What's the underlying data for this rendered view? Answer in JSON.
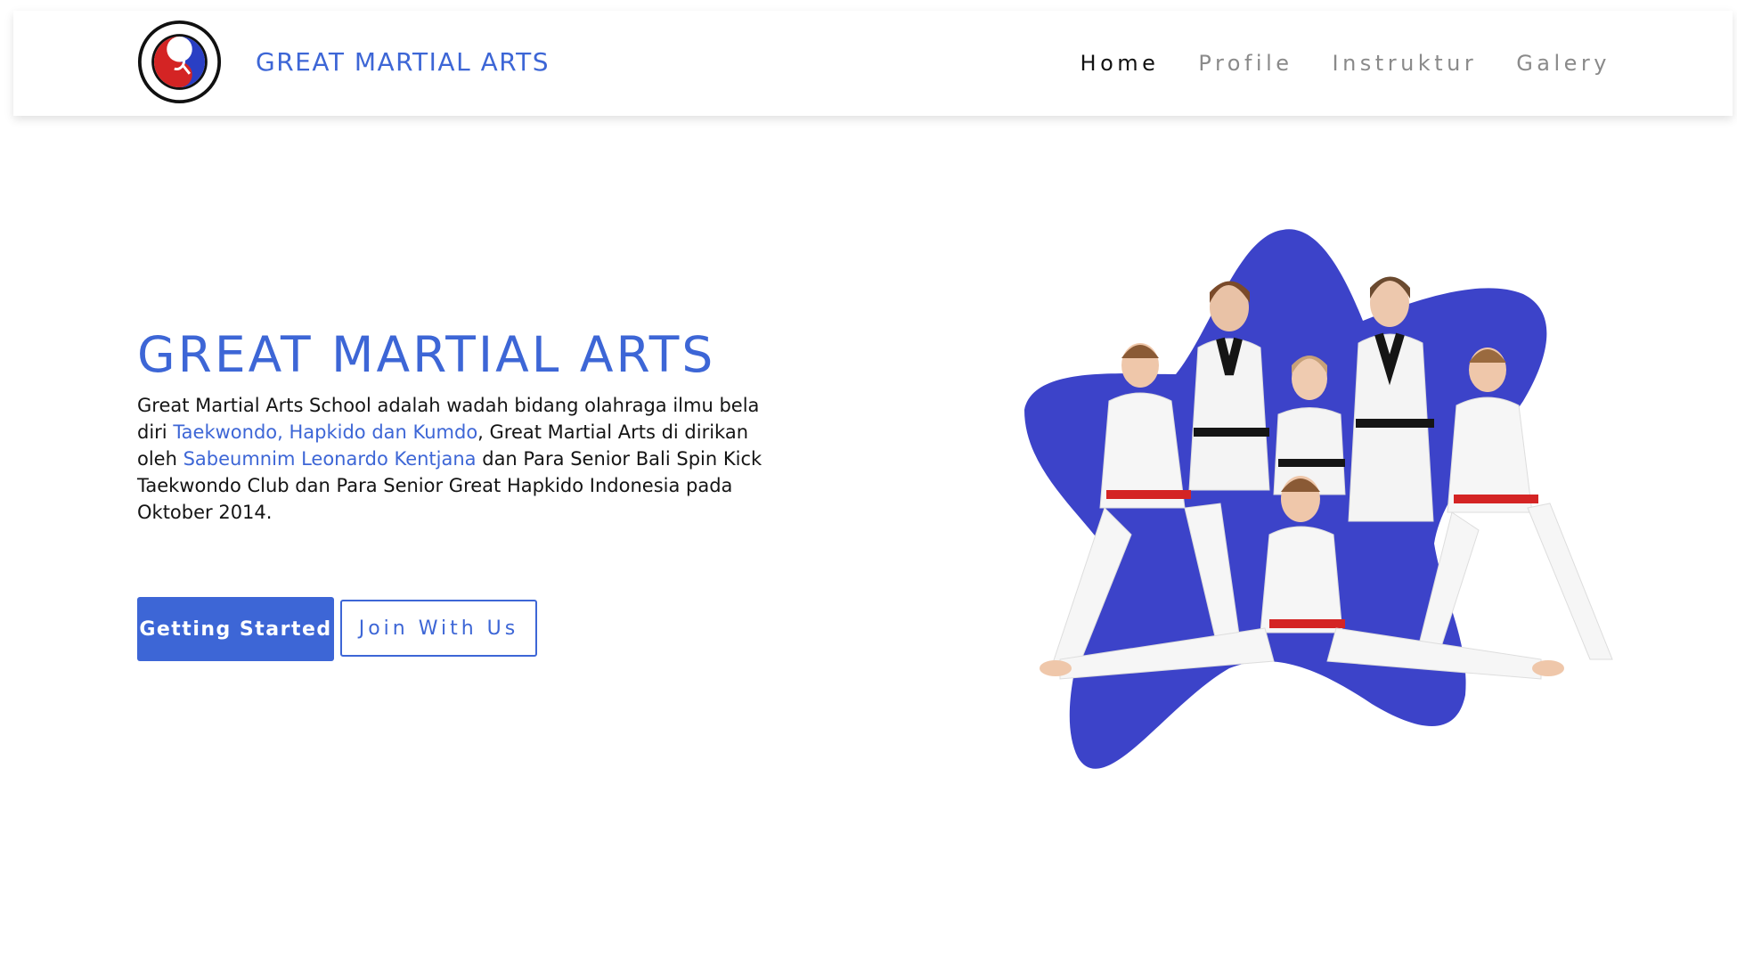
{
  "header": {
    "brand_name": "GREAT MARTIAL ARTS",
    "logo_icon": "great-martial-arts-school-logo",
    "nav": [
      {
        "label": "Home",
        "active": true
      },
      {
        "label": "Profile",
        "active": false
      },
      {
        "label": "Instruktur",
        "active": false
      },
      {
        "label": "Galery",
        "active": false
      }
    ]
  },
  "hero": {
    "title": "GREAT MARTIAL ARTS",
    "text_1": "Great Martial Arts School adalah wadah bidang olahraga ilmu bela diri ",
    "highlight_1": "Taekwondo, Hapkido dan Kumdo",
    "text_2": ", Great Martial Arts di dirikan oleh ",
    "highlight_2": "Sabeumnim Leonardo Kentjana",
    "text_3": " dan Para Senior Bali Spin Kick Taekwondo Club dan Para Senior Great Hapkido Indonesia pada Oktober 2014.",
    "primary_button": "Getting Started",
    "secondary_button": "Join With Us"
  },
  "colors": {
    "accent": "#3d66d6",
    "blob": "#3c43c9",
    "belt_red": "#d42424",
    "belt_black": "#151515"
  },
  "illustration": {
    "description_icon": "martial-arts-students-group-image"
  }
}
